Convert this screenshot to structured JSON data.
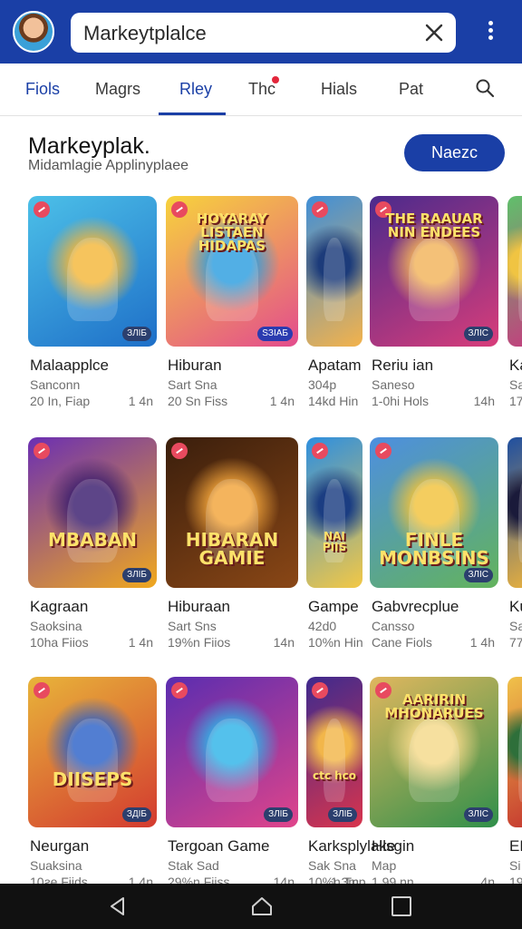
{
  "search": {
    "value": "Markeytplalce"
  },
  "tabs": [
    {
      "label": "Fiols",
      "active": false
    },
    {
      "label": "Magrs",
      "active": false
    },
    {
      "label": "Rley",
      "active": true
    },
    {
      "label": "Thc",
      "active": false
    },
    {
      "label": "Hials",
      "active": false
    },
    {
      "label": "Pat",
      "active": false
    }
  ],
  "section": {
    "title": "Markeyplak.",
    "subtitle": "Midamlagie Applinyplaee",
    "button_label": "Naezc"
  },
  "rows": [
    {
      "cards": [
        {
          "title": "Malaapplce",
          "subtitle": "Sanconn",
          "meta": "20 In, Fiap",
          "size": "1 4n",
          "badge": "ЗЛІБ",
          "art_title": "",
          "colors": [
            "#4cc0e8",
            "#1e6fc8",
            "#f4b73a"
          ]
        },
        {
          "title": "Hiburan",
          "subtitle": "Sart Sna",
          "meta": "20 Sn Fiss",
          "size": "1 4n",
          "badge": "SЗІАБ",
          "art_title": "HOYARAY LISTAEN HIDAPAS",
          "colors": [
            "#f7d33c",
            "#e34c8d",
            "#2d9ee0"
          ]
        },
        {
          "title": "Apatam",
          "subtitle": "304p",
          "meta": "14kd Hin",
          "size": "",
          "badge": "",
          "art_title": "",
          "colors": [
            "#3f8fd8",
            "#f3b24b",
            "#1c3b7a"
          ]
        },
        {
          "title": "Reriu ian",
          "subtitle": "Saneso",
          "meta": "1-0hi Hols",
          "size": "14h",
          "badge": "ЗЛІС",
          "art_title": "THE RAAUAR NIN ENDEES",
          "colors": [
            "#4b2a8c",
            "#d83d7a",
            "#f2b45b"
          ]
        },
        {
          "title": "Ka",
          "subtitle": "Sa",
          "meta": "17",
          "size": "",
          "badge": "",
          "art_title": "",
          "colors": [
            "#5fc06b",
            "#c73a7f",
            "#f0c442"
          ]
        }
      ]
    },
    {
      "cards": [
        {
          "title": "Kagraan",
          "subtitle": "Saoksina",
          "meta": "10ha Fiios",
          "size": "1 4n",
          "badge": "ЗЛІБ",
          "art_title": "MBABAN",
          "colors": [
            "#6b2fb3",
            "#f0a81e",
            "#3a1d6e"
          ]
        },
        {
          "title": "Hiburaan",
          "subtitle": "Sart Sns",
          "meta": "19%n Fiios",
          "size": "14n",
          "badge": "",
          "art_title": "HIBARAN GAMIE",
          "colors": [
            "#3a1e0c",
            "#8a4716",
            "#f2a43a"
          ]
        },
        {
          "title": "Gampe",
          "subtitle": "42d0",
          "meta": "10%n Hin",
          "size": "",
          "badge": "",
          "art_title": "NAI PIIS",
          "colors": [
            "#2d8fe0",
            "#f3c845",
            "#1b3d82"
          ]
        },
        {
          "title": "Gabvrecplue",
          "subtitle": "Cansso",
          "meta": "Cane Fiols",
          "size": "1 4h",
          "badge": "ЗЛІС",
          "art_title": "FINLE MONBSINS",
          "colors": [
            "#4d8fe0",
            "#63b35c",
            "#f2c33c"
          ]
        },
        {
          "title": "Ku",
          "subtitle": "Sa",
          "meta": "77",
          "size": "",
          "badge": "",
          "art_title": "",
          "colors": [
            "#1f4fa0",
            "#f0b43a",
            "#1a1a3a"
          ]
        }
      ]
    },
    {
      "cards": [
        {
          "title": "Neurgan",
          "subtitle": "Suaksina",
          "meta": "10ƨe Fiids",
          "size": "1 4n",
          "badge": "ЗДІБ",
          "art_title": "DIISEPS",
          "colors": [
            "#e8b43a",
            "#d33a2f",
            "#2c62c8"
          ]
        },
        {
          "title": "Tergoan Game",
          "subtitle": "Stak Sad",
          "meta": "29%n Fiiss",
          "size": "14n",
          "badge": "ЗЛІБ",
          "art_title": "",
          "colors": [
            "#5a2db0",
            "#e0448a",
            "#2fb4e8"
          ]
        },
        {
          "title": "Karksplylake",
          "subtitle": "Sak Sna",
          "meta": "10%n Tnp",
          "size": "1 3m",
          "badge": "ЗЛІБ",
          "art_title": "ctc hco",
          "colors": [
            "#3e2a8e",
            "#d8344d",
            "#f2b64a"
          ]
        },
        {
          "title": "Hlsgin",
          "subtitle": "Map",
          "meta": "1 99 nn",
          "size": "4n",
          "badge": "ЗЛІС",
          "art_title": "AARIRIN MHONARUES",
          "colors": [
            "#e0b75e",
            "#2f8f4a",
            "#f5d98a"
          ]
        },
        {
          "title": "EL",
          "subtitle": "Si",
          "meta": "19",
          "size": "",
          "badge": "",
          "art_title": "",
          "colors": [
            "#f0c24a",
            "#c4342f",
            "#2e6f3a"
          ]
        }
      ]
    }
  ]
}
